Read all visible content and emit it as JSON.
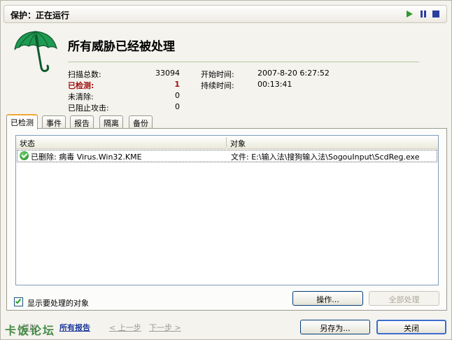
{
  "titlebar": {
    "title": "保护：正在运行"
  },
  "header": {
    "headline": "所有威胁已经被处理"
  },
  "stats": {
    "scanned_label": "扫描总数:",
    "scanned_value": "33094",
    "detected_label": "已检测:",
    "detected_value": "1",
    "unremoved_label": "未清除:",
    "unremoved_value": "0",
    "blocked_label": "已阻止攻击:",
    "blocked_value": "0",
    "start_label": "开始时间:",
    "start_value": "2007-8-20 6:27:52",
    "duration_label": "持续时间:",
    "duration_value": "00:13:41"
  },
  "tabs": [
    {
      "label": "已检测"
    },
    {
      "label": "事件"
    },
    {
      "label": "报告"
    },
    {
      "label": "隔离"
    },
    {
      "label": "备份"
    }
  ],
  "table": {
    "columns": [
      "状态",
      "对象"
    ],
    "rows": [
      {
        "status": "已删除: 病毒 Virus.Win32.KME",
        "object": "文件: E:\\输入法\\搜狗输入法\\SogouInput\\ScdReg.exe"
      }
    ]
  },
  "options": {
    "show_pending_label": "显示要处理的对象",
    "show_pending_checked": true
  },
  "buttons": {
    "operate": "操作...",
    "process_all": "全部处理",
    "save_as": "另存为...",
    "close": "关闭"
  },
  "footer": {
    "help": "帮助",
    "all_reports": "所有报告",
    "prev": "< 上一步",
    "next": "下一步 >",
    "watermark": "卡饭论坛"
  },
  "colors": {
    "accent_red": "#a01010",
    "tab_highlight": "#f0a838",
    "link_blue": "#1c3a9c"
  },
  "icons": {
    "umbrella": "umbrella-logo",
    "ok": "check-circle-icon"
  }
}
